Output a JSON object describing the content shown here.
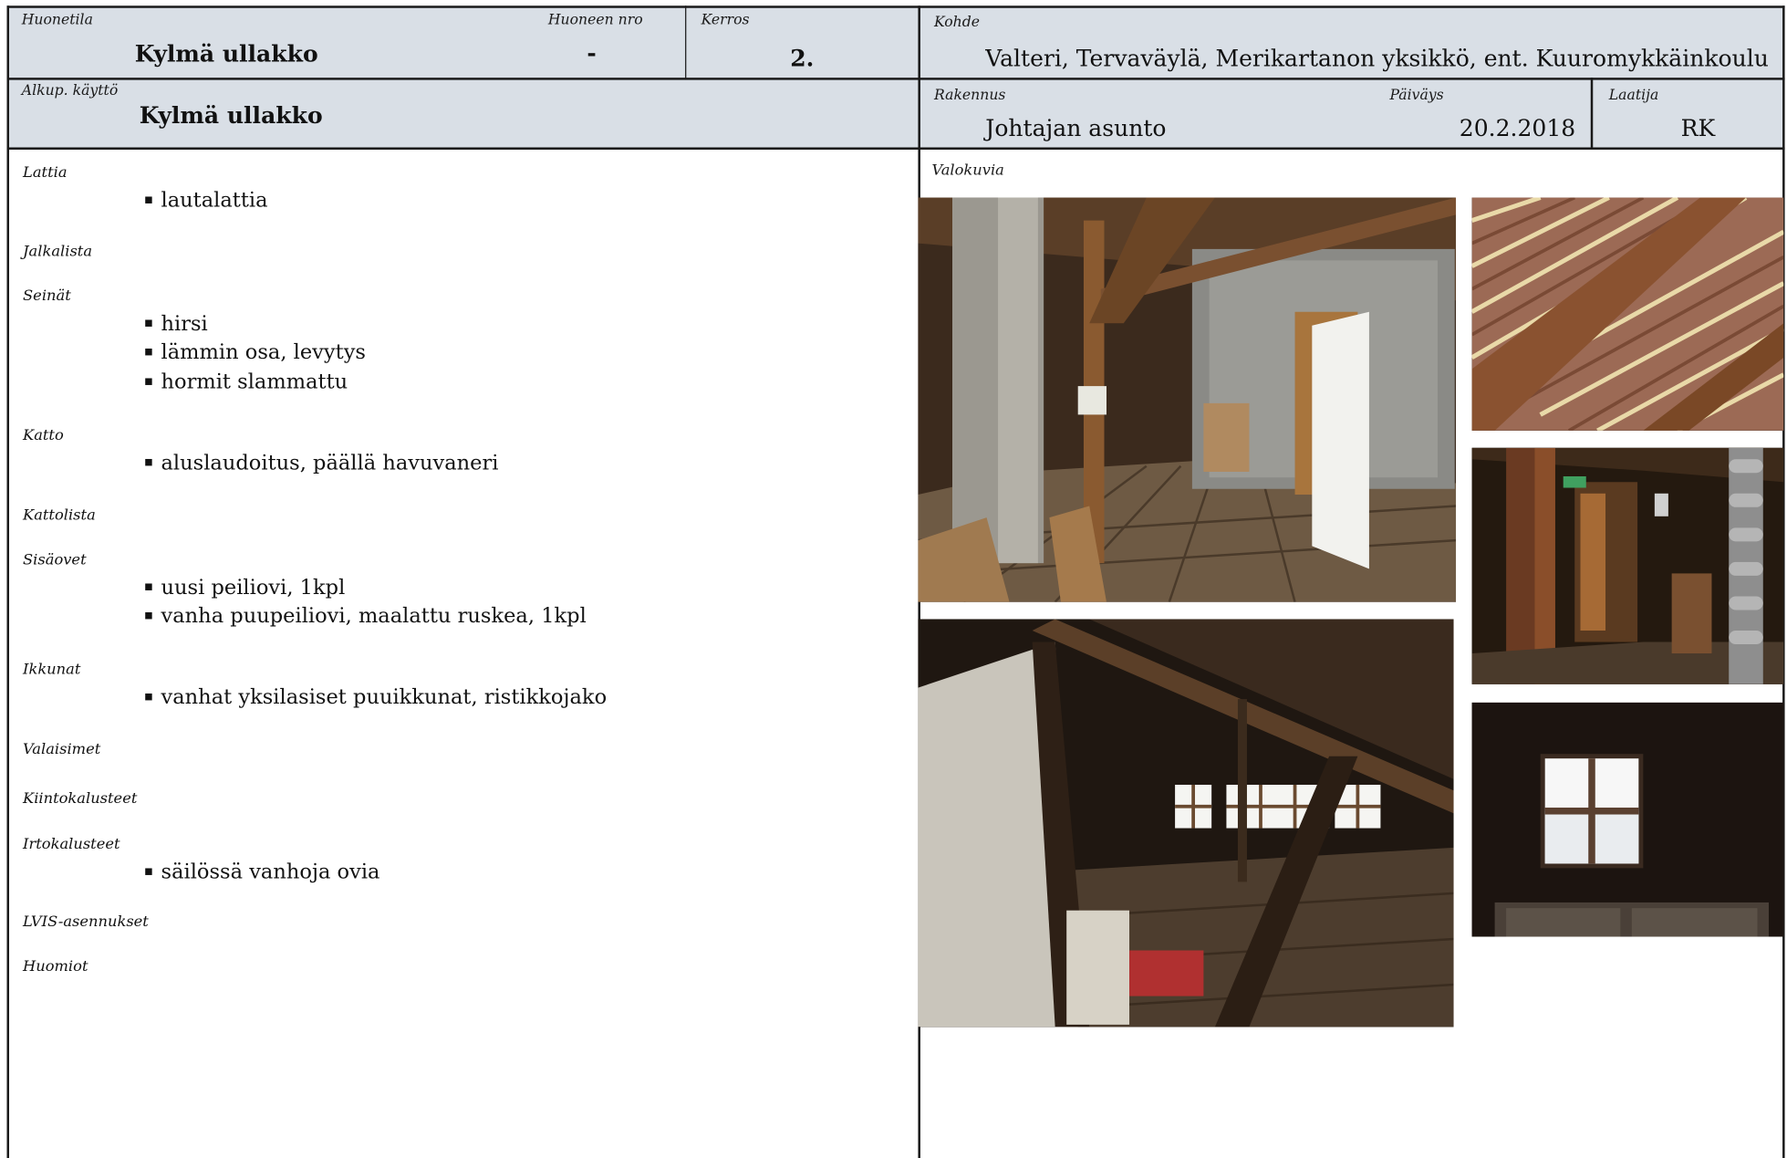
{
  "header": {
    "huonetila_label": "Huonetila",
    "huonetila_value": "Kylmä ullakko",
    "huoneen_nro_label": "Huoneen nro",
    "huoneen_nro_value": "-",
    "kerros_label": "Kerros",
    "kerros_value": "2.",
    "kohde_label": "Kohde",
    "kohde_value": "Valteri, Tervaväylä, Merikartanon yksikkö, ent. Kuuromykkäinkoulu",
    "alkup_label": "Alkup. käyttö",
    "alkup_value": "Kylmä ullakko",
    "rakennus_label": "Rakennus",
    "rakennus_value": "Johtajan asunto",
    "paivays_label": "Päiväys",
    "paivays_value": "20.2.2018",
    "laatija_label": "Laatija",
    "laatija_value": "RK"
  },
  "sections": [
    {
      "label": "Lattia",
      "items": [
        "lautalattia"
      ]
    },
    {
      "label": "Jalkalista",
      "items": []
    },
    {
      "label": "Seinät",
      "items": [
        "hirsi",
        "lämmin osa, levytys",
        "hormit slammattu"
      ]
    },
    {
      "label": "Katto",
      "items": [
        "aluslaudoitus, päällä havuvaneri"
      ]
    },
    {
      "label": "Kattolista",
      "items": []
    },
    {
      "label": "Sisäovet",
      "items": [
        "uusi peiliovi, 1kpl",
        "vanha puupeiliovi, maalattu ruskea, 1kpl"
      ]
    },
    {
      "label": "Ikkunat",
      "items": [
        "vanhat yksilasiset puuikkunat, ristikkojako"
      ]
    },
    {
      "label": "Valaisimet",
      "items": []
    },
    {
      "label": "Kiintokalusteet",
      "items": []
    },
    {
      "label": "Irtokalusteet",
      "items": [
        "säilössä vanhoja ovia"
      ]
    },
    {
      "label": "LVIS-asennukset",
      "items": []
    },
    {
      "label": "Huomiot",
      "items": []
    }
  ],
  "photos": {
    "label": "Valokuvia",
    "bullet": "▪"
  }
}
